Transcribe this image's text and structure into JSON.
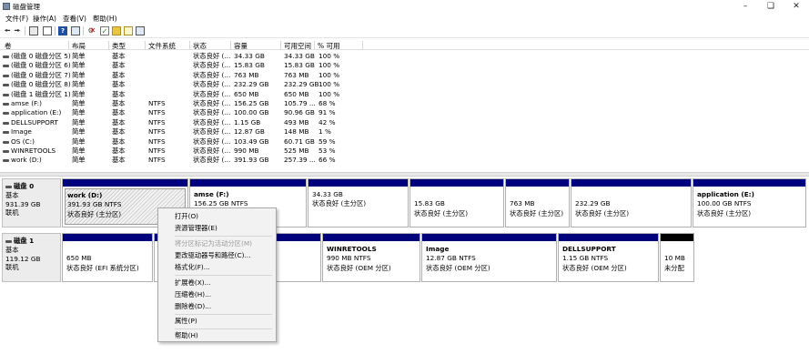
{
  "window": {
    "title": "磁盘管理",
    "minimize_icon": "minimize-icon",
    "maximize_icon": "restore-icon",
    "close_icon": "close-icon"
  },
  "menubar": [
    "文件(F)",
    "操作(A)",
    "查看(V)",
    "帮助(H)"
  ],
  "toolbar": [
    "back-arrow-icon",
    "forward-arrow-icon",
    "console-tree-icon",
    "properties-icon",
    "help-icon",
    "view-icon",
    "connect-icon",
    "delete-icon",
    "check-icon",
    "folder-icon",
    "new-icon",
    "export-icon"
  ],
  "list": {
    "columns": [
      "卷",
      "布局",
      "类型",
      "文件系统",
      "状态",
      "容量",
      "可用空间",
      "% 可用"
    ],
    "rows": [
      [
        "(磁盘 0 磁盘分区 5)",
        "简单",
        "基本",
        "",
        "状态良好 (...",
        "34.33 GB",
        "34.33 GB",
        "100 %"
      ],
      [
        "(磁盘 0 磁盘分区 6)",
        "简单",
        "基本",
        "",
        "状态良好 (...",
        "15.83 GB",
        "15.83 GB",
        "100 %"
      ],
      [
        "(磁盘 0 磁盘分区 7)",
        "简单",
        "基本",
        "",
        "状态良好 (...",
        "763 MB",
        "763 MB",
        "100 %"
      ],
      [
        "(磁盘 0 磁盘分区 8)",
        "简单",
        "基本",
        "",
        "状态良好 (...",
        "232.29 GB",
        "232.29 GB",
        "100 %"
      ],
      [
        "(磁盘 1 磁盘分区 1)",
        "简单",
        "基本",
        "",
        "状态良好 (...",
        "650 MB",
        "650 MB",
        "100 %"
      ],
      [
        "amse (F:)",
        "简单",
        "基本",
        "NTFS",
        "状态良好 (...",
        "156.25 GB",
        "105.79 ...",
        "68 %"
      ],
      [
        "application (E:)",
        "简单",
        "基本",
        "NTFS",
        "状态良好 (...",
        "100.00 GB",
        "90.96 GB",
        "91 %"
      ],
      [
        "DELLSUPPORT",
        "简单",
        "基本",
        "NTFS",
        "状态良好 (...",
        "1.15 GB",
        "493 MB",
        "42 %"
      ],
      [
        "Image",
        "简单",
        "基本",
        "NTFS",
        "状态良好 (...",
        "12.87 GB",
        "148 MB",
        "1 %"
      ],
      [
        "OS (C:)",
        "简单",
        "基本",
        "NTFS",
        "状态良好 (...",
        "103.49 GB",
        "60.71 GB",
        "59 %"
      ],
      [
        "WINRETOOLS",
        "简单",
        "基本",
        "NTFS",
        "状态良好 (...",
        "990 MB",
        "525 MB",
        "53 %"
      ],
      [
        "work (D:)",
        "简单",
        "基本",
        "NTFS",
        "状态良好 (...",
        "391.93 GB",
        "257.39 ...",
        "66 %"
      ]
    ]
  },
  "disks": [
    {
      "name": "磁盘 0",
      "lines": [
        "基本",
        "931.39 GB",
        "联机"
      ],
      "partitions": [
        {
          "name": "work  (D:)",
          "line1": "391.93 GB NTFS",
          "line2": "状态良好 (主分区)"
        },
        {
          "name": "amse  (F:)",
          "line1": "156.25 GB NTFS",
          "line2": ""
        },
        {
          "name": "",
          "line1": "34.33 GB",
          "line2": "状态良好 (主分区)"
        },
        {
          "name": "",
          "line1": "15.83 GB",
          "line2": "状态良好 (主分区)"
        },
        {
          "name": "",
          "line1": "763 MB",
          "line2": "状态良好 (主分区)"
        },
        {
          "name": "",
          "line1": "232.29 GB",
          "line2": "状态良好 (主分区)"
        },
        {
          "name": "application  (E:)",
          "line1": "100.00 GB NTFS",
          "line2": "状态良好 (主分区)"
        }
      ]
    },
    {
      "name": "磁盘 1",
      "lines": [
        "基本",
        "119.12 GB",
        "联机"
      ],
      "partitions": [
        {
          "name": "",
          "line1": "650 MB",
          "line2": "状态良好 (EFI 系统分区)"
        },
        {
          "name": "",
          "line1": "",
          "line2": ""
        },
        {
          "name": "WINRETOOLS",
          "line1": "990 MB NTFS",
          "line2": "状态良好 (OEM 分区)"
        },
        {
          "name": "Image",
          "line1": "12.87 GB NTFS",
          "line2": "状态良好 (OEM 分区)"
        },
        {
          "name": "DELLSUPPORT",
          "line1": "1.15 GB NTFS",
          "line2": "状态良好 (OEM 分区)"
        },
        {
          "name": "",
          "line1": "10 MB",
          "line2": "未分配"
        }
      ]
    }
  ],
  "context_menu": {
    "items": [
      "打开(O)",
      "资源管理器(E)",
      "将分区标记为活动分区(M)",
      "更改驱动器号和路径(C)...",
      "格式化(F)...",
      "扩展卷(X)...",
      "压缩卷(H)...",
      "删除卷(D)...",
      "属性(P)",
      "帮助(H)"
    ]
  },
  "colors": {
    "partition_bar": "#00007d",
    "unallocated_bar": "#000000"
  }
}
